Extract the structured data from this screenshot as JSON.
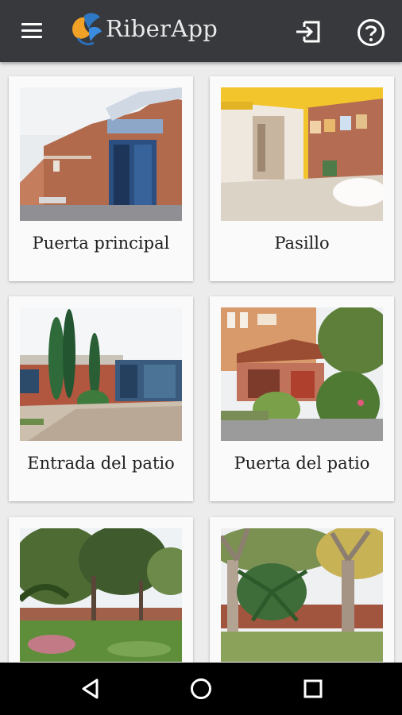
{
  "app": {
    "title": "RiberApp"
  },
  "toolbar": {
    "menu_icon": "menu-icon",
    "login_icon": "login-icon",
    "help_icon": "help-circle-icon"
  },
  "cards": [
    {
      "label": "Puerta principal"
    },
    {
      "label": "Pasillo"
    },
    {
      "label": "Entrada del patio"
    },
    {
      "label": "Puerta del patio"
    },
    {
      "label": ""
    },
    {
      "label": ""
    }
  ],
  "navbar": {
    "back_icon": "back-triangle-icon",
    "home_icon": "home-circle-icon",
    "recents_icon": "recents-square-icon"
  },
  "colors": {
    "appbar": "#37393c",
    "background": "#ececec",
    "card": "#fafafa",
    "navbar": "#000000"
  }
}
